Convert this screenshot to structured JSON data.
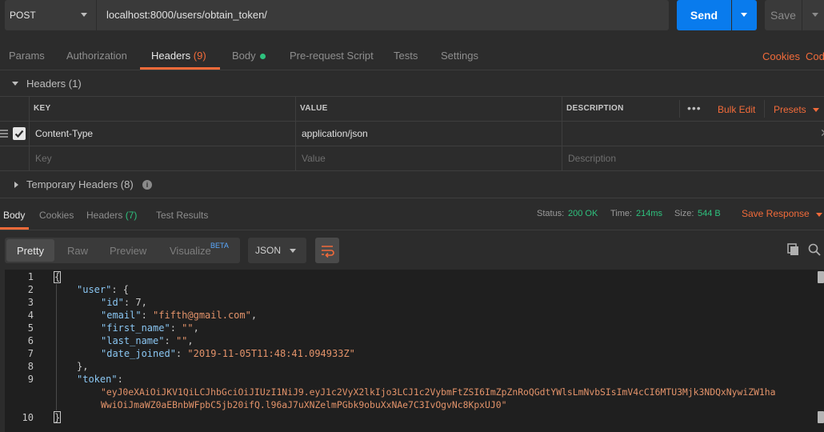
{
  "request": {
    "method": "POST",
    "url": "localhost:8000/users/obtain_token/",
    "send_label": "Send",
    "save_label": "Save"
  },
  "request_tabs": {
    "params": "Params",
    "authorization": "Authorization",
    "headers": "Headers",
    "headers_count": "(9)",
    "body": "Body",
    "prerequest": "Pre-request Script",
    "tests": "Tests",
    "settings": "Settings",
    "cookies": "Cookies",
    "code": "Code"
  },
  "headers_section": {
    "title": "Headers",
    "count": "(1)",
    "columns": {
      "key": "KEY",
      "value": "VALUE",
      "description": "DESCRIPTION"
    },
    "more_icon": "more-icon",
    "bulk_edit": "Bulk Edit",
    "presets": "Presets",
    "rows": [
      {
        "key": "Content-Type",
        "value": "application/json",
        "description": ""
      }
    ],
    "placeholders": {
      "key": "Key",
      "value": "Value",
      "description": "Description"
    },
    "temporary_title": "Temporary Headers",
    "temporary_count": "(8)"
  },
  "response": {
    "tabs": {
      "body": "Body",
      "cookies": "Cookies",
      "headers": "Headers",
      "headers_count": "(7)",
      "test_results": "Test Results"
    },
    "status_label": "Status:",
    "status_value": "200 OK",
    "time_label": "Time:",
    "time_value": "214ms",
    "size_label": "Size:",
    "size_value": "544 B",
    "save_response": "Save Response",
    "view_modes": {
      "pretty": "Pretty",
      "raw": "Raw",
      "preview": "Preview",
      "visualize": "Visualize",
      "beta": "BETA"
    },
    "format": "JSON",
    "line_numbers": [
      "1",
      "2",
      "3",
      "4",
      "5",
      "6",
      "7",
      "8",
      "9",
      "",
      "10"
    ],
    "code": {
      "l1": "{",
      "user_key": "\"user\"",
      "id_key": "\"id\"",
      "id_val": "7",
      "email_key": "\"email\"",
      "email_val": "\"fifth@gmail.com\"",
      "first_key": "\"first_name\"",
      "first_val": "\"\"",
      "last_key": "\"last_name\"",
      "last_val": "\"\"",
      "date_key": "\"date_joined\"",
      "date_val": "\"2019-11-05T11:48:41.094933Z\"",
      "token_key": "\"token\"",
      "token_val_1": "\"eyJ0eXAiOiJKV1QiLCJhbGciOiJIUzI1NiJ9.eyJ1c2VyX2lkIjo3LCJ1c2VybmFtZSI6ImZpZnRoQGdtYWlsLmNvbSIsImV4cCI6MTU3Mjk3NDQxNywiZW1ha",
      "token_val_2": "WwiOiJmaWZ0aEBnbWFpbC5jb20ifQ.l96aJ7uXNZelmPGbk9obuXxNAe7C3IvOgvNc8KpxUJ0\"",
      "l10": "}"
    }
  }
}
